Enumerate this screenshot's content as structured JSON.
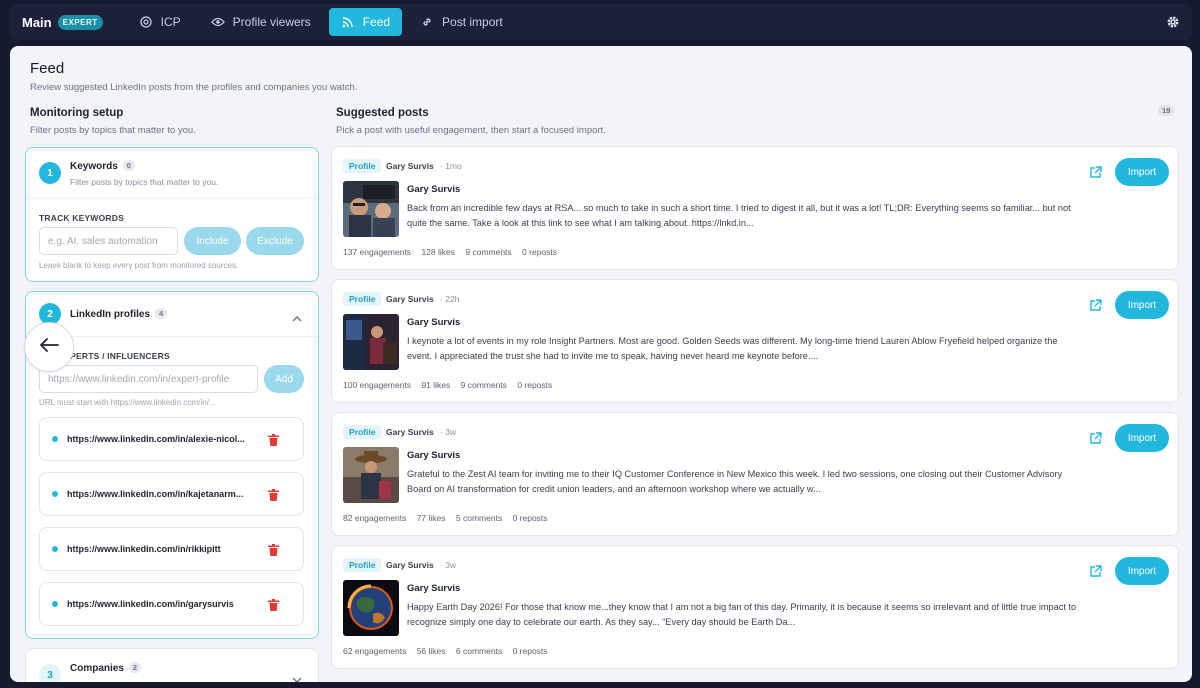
{
  "topbar": {
    "brand": "Main",
    "badge": "EXPERT",
    "nav": [
      {
        "label": "ICP",
        "icon": "target-icon"
      },
      {
        "label": "Profile viewers",
        "icon": "eye-icon"
      },
      {
        "label": "Feed",
        "icon": "rss-icon",
        "active": true
      },
      {
        "label": "Post import",
        "icon": "link-icon"
      }
    ],
    "settings_icon": "gear-icon"
  },
  "page": {
    "title": "Feed",
    "subtitle": "Review suggested LinkedIn posts from the profiles and companies you watch."
  },
  "monitoring": {
    "title": "Monitoring setup",
    "subtitle": "Filter posts by topics that matter to you.",
    "keywords": {
      "step": "1",
      "title": "Keywords",
      "count": "0",
      "subtitle": "Filter posts by topics that matter to you.",
      "track_label": "TRACK KEYWORDS",
      "placeholder": "e.g. AI, sales automation",
      "include_label": "Include",
      "exclude_label": "Exclude",
      "hint": "Leave blank to keep every post from monitored sources."
    },
    "profiles": {
      "step": "2",
      "title": "LinkedIn profiles",
      "count": "4",
      "section_label": "ES / EXPERTS / INFLUENCERS",
      "placeholder": "https://www.linkedin.com/in/expert-profile",
      "add_label": "Add",
      "hint": "URL must start with https://www.linkedin.com/in/...",
      "items": [
        "https://www.linkedin.com/in/alexie-nicol...",
        "https://www.linkedin.com/in/kajetanarm...",
        "https://www.linkedin.com/in/rikkipitt",
        "https://www.linkedin.com/in/garysurvis"
      ]
    },
    "companies": {
      "step": "3",
      "title": "Companies",
      "count": "2"
    }
  },
  "suggested": {
    "title": "Suggested posts",
    "subtitle": "Pick a post with useful engagement, then start a focused import.",
    "total": "19",
    "import_label": "Import",
    "posts": [
      {
        "tag": "Profile",
        "author_top": "Gary Survis",
        "time": "1mo",
        "author": "Gary Survis",
        "text": "Back from an incredible few days at RSA... so much to take in such a short time. I tried to digest it all, but it was a lot! TL;DR: Everything seems so familiar... but not quite the same. Take a look at this link to see what I am talking about. https://lnkd.in...",
        "engagements": "137 engagements",
        "likes": "128 likes",
        "comments": "9 comments",
        "reposts": "0 reposts",
        "image": "conference-selfie"
      },
      {
        "tag": "Profile",
        "author_top": "Gary Survis",
        "time": "22h",
        "author": "Gary Survis",
        "text": "I keynote a lot of events in my role Insight Partners. Most are good. Golden Seeds was different. My long-time friend Lauren Ablow Fryefield helped organize the event. I appreciated the trust she had to invite me to speak, having never heard me keynote before....",
        "engagements": "100 engagements",
        "likes": "91 likes",
        "comments": "9 comments",
        "reposts": "0 reposts",
        "image": "keynote-speaker"
      },
      {
        "tag": "Profile",
        "author_top": "Gary Survis",
        "time": "3w",
        "author": "Gary Survis",
        "text": "Grateful to the Zest AI team for inviting me to their IQ Customer Conference in New Mexico this week. I led two sessions, one closing out their Customer Advisory Board on AI transformation for credit union leaders, and an afternoon workshop where we actually w...",
        "engagements": "82 engagements",
        "likes": "77 likes",
        "comments": "5 comments",
        "reposts": "0 reposts",
        "image": "cowboy-hat-speaker"
      },
      {
        "tag": "Profile",
        "author_top": "Gary Survis",
        "time": "3w",
        "author": "Gary Survis",
        "text": "Happy Earth Day 2026! For those that know me...they know that I am not a big fan of this day. Primarily, it is because it seems so irrelevant and of little true impact to recognize simply one day to celebrate our earth. As they say... \"Every day should be Earth Da...",
        "engagements": "62 engagements",
        "likes": "56 likes",
        "comments": "6 comments",
        "reposts": "0 reposts",
        "image": "burning-earth"
      }
    ]
  },
  "colors": {
    "accent": "#22b8de",
    "background": "#161a2e",
    "panel": "#f3f4f7",
    "danger": "#e53935"
  }
}
